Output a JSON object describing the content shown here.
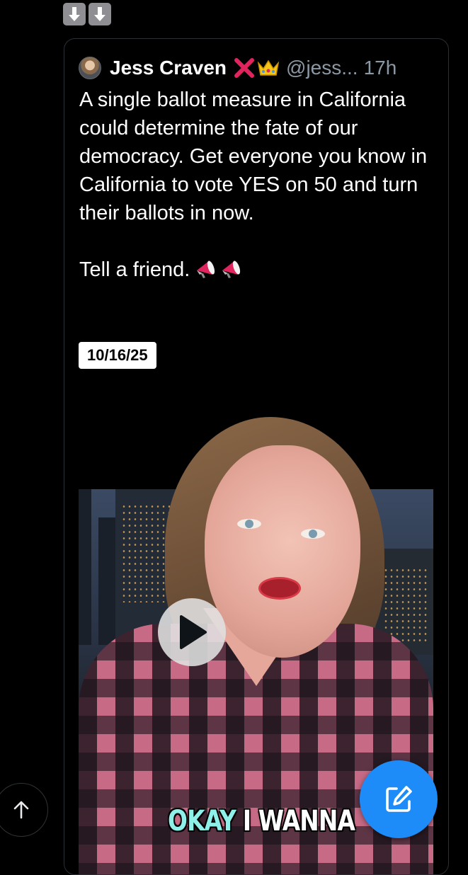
{
  "header": {
    "icons": [
      "down-arrow-emoji",
      "down-arrow-emoji"
    ]
  },
  "quoted_post": {
    "author": {
      "display_name": "Jess Craven",
      "name_emojis": [
        "cross-mark-emoji",
        "crown-emoji"
      ],
      "handle": "@jess...",
      "time": "17h"
    },
    "text": "A single ballot measure in California could determine the fate of our democracy. Get everyone you know in California to vote YES on 50 and turn their ballots in now.\n\nTell a friend.",
    "text_emojis": [
      "megaphone-emoji",
      "megaphone-emoji"
    ],
    "date_badge": "10/16/25",
    "video": {
      "caption_word_1": "OKAY",
      "caption_word_2": "I WANNA"
    }
  },
  "colors": {
    "background": "#000000",
    "card_border": "#2b2f36",
    "muted_text": "#8b98a5",
    "compose_button": "#1d8cf8",
    "caption_highlight": "#8ff0ea"
  }
}
